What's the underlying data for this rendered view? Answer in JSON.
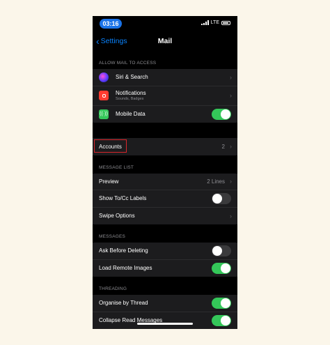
{
  "status": {
    "time": "03:16",
    "network": "LTE"
  },
  "nav": {
    "back_label": "Settings",
    "title": "Mail"
  },
  "allow_access": {
    "header": "ALLOW MAIL TO ACCESS",
    "siri": {
      "label": "Siri & Search"
    },
    "notifications": {
      "label": "Notifications",
      "sub": "Sounds, Badges"
    },
    "mobile_data": {
      "label": "Mobile Data",
      "on": true
    }
  },
  "accounts": {
    "label": "Accounts",
    "count": "2"
  },
  "message_list": {
    "header": "MESSAGE LIST",
    "preview": {
      "label": "Preview",
      "value": "2 Lines"
    },
    "show_tocc": {
      "label": "Show To/Cc Labels",
      "on": false
    },
    "swipe": {
      "label": "Swipe Options"
    }
  },
  "messages": {
    "header": "MESSAGES",
    "ask_delete": {
      "label": "Ask Before Deleting",
      "on": false
    },
    "load_remote": {
      "label": "Load Remote Images",
      "on": true
    }
  },
  "threading": {
    "header": "THREADING",
    "organise": {
      "label": "Organise by Thread",
      "on": true
    },
    "collapse": {
      "label": "Collapse Read Messages",
      "on": true
    }
  },
  "colors": {
    "accent": "#0a84ff",
    "toggle_on": "#34c759",
    "highlight": "#d9262b",
    "background": "#fbf6ea"
  },
  "icons": {
    "siri": "siri-icon",
    "notifications": "notifications-icon",
    "mobile_data": "mobile-data-icon"
  }
}
